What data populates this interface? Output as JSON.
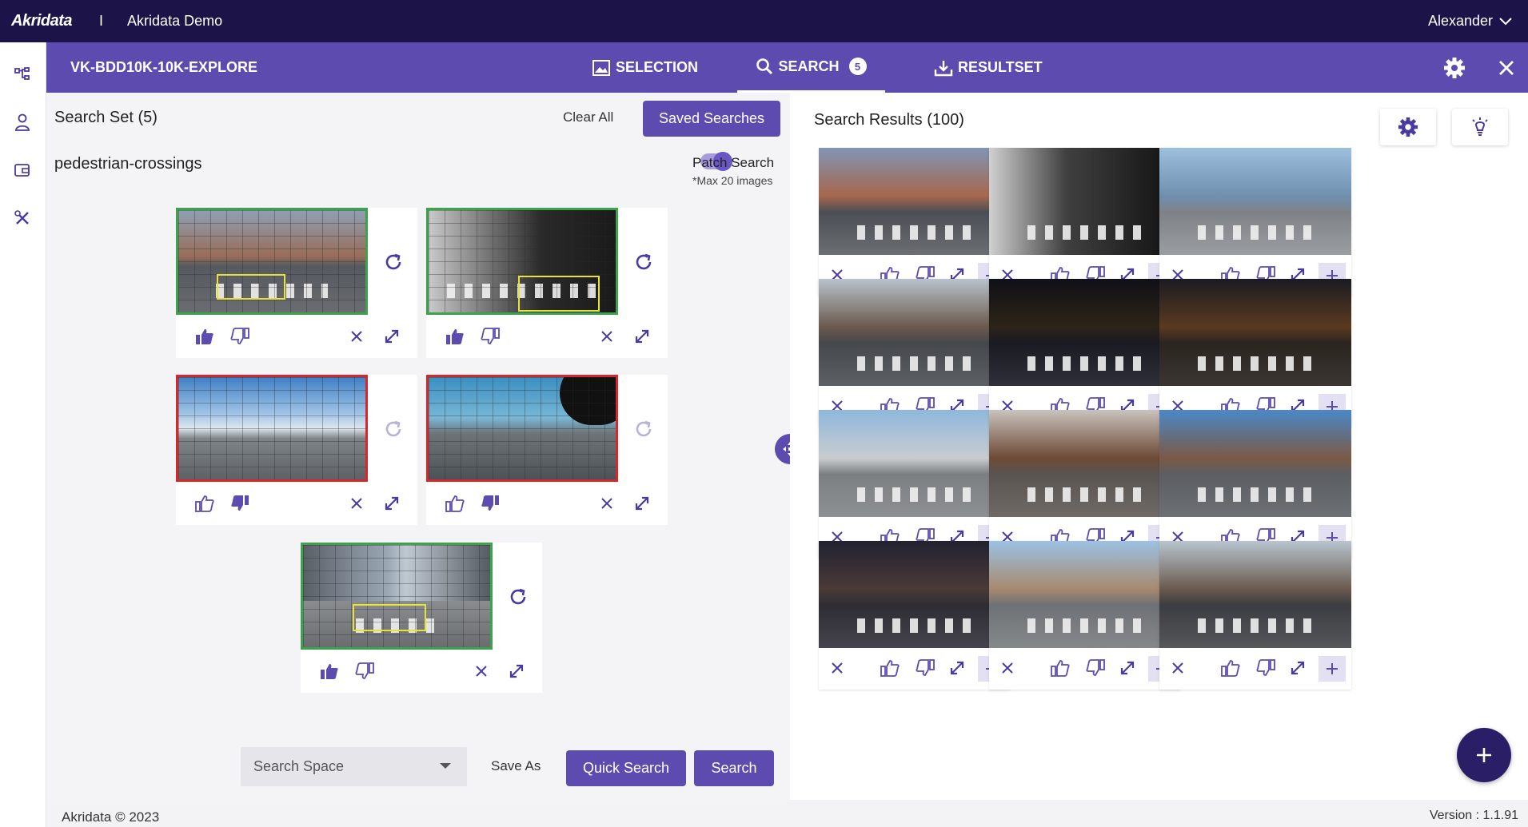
{
  "topbar": {
    "logo": "Akridata",
    "separator": "I",
    "app_name": "Akridata Demo",
    "user": "Alexander"
  },
  "projectbar": {
    "project": "VK-BDD10K-10K-EXPLORE",
    "tabs": [
      {
        "label": "SELECTION",
        "icon": "image-icon"
      },
      {
        "label": "SEARCH",
        "icon": "search-icon",
        "badge": "5"
      },
      {
        "label": "RESULTSET",
        "icon": "download-icon"
      }
    ]
  },
  "search_set": {
    "title": "Search Set",
    "count": "(5)",
    "clear_all": "Clear All",
    "saved_searches": "Saved Searches",
    "name": "pedestrian-crossings",
    "patch_search": "Patch Search",
    "patch_note": "*Max 20 images",
    "search_space_placeholder": "Search Space",
    "save_as": "Save As",
    "quick_search": "Quick Search",
    "search": "Search",
    "items": [
      {
        "feedback": "positive",
        "border": "#3ca34a"
      },
      {
        "feedback": "positive",
        "border": "#3ca34a"
      },
      {
        "feedback": "negative",
        "border": "#d8262b"
      },
      {
        "feedback": "negative",
        "border": "#d8262b"
      },
      {
        "feedback": "positive",
        "border": "#3ca34a"
      }
    ]
  },
  "results": {
    "title": "Search Results",
    "count": "(100)"
  },
  "footer": {
    "copyright": "Akridata © 2023",
    "version": "Version : 1.1.91"
  },
  "colors": {
    "topbar": "#1c1448",
    "accent": "#5d4bb0",
    "positive": "#3ca34a",
    "negative": "#d8262b"
  }
}
